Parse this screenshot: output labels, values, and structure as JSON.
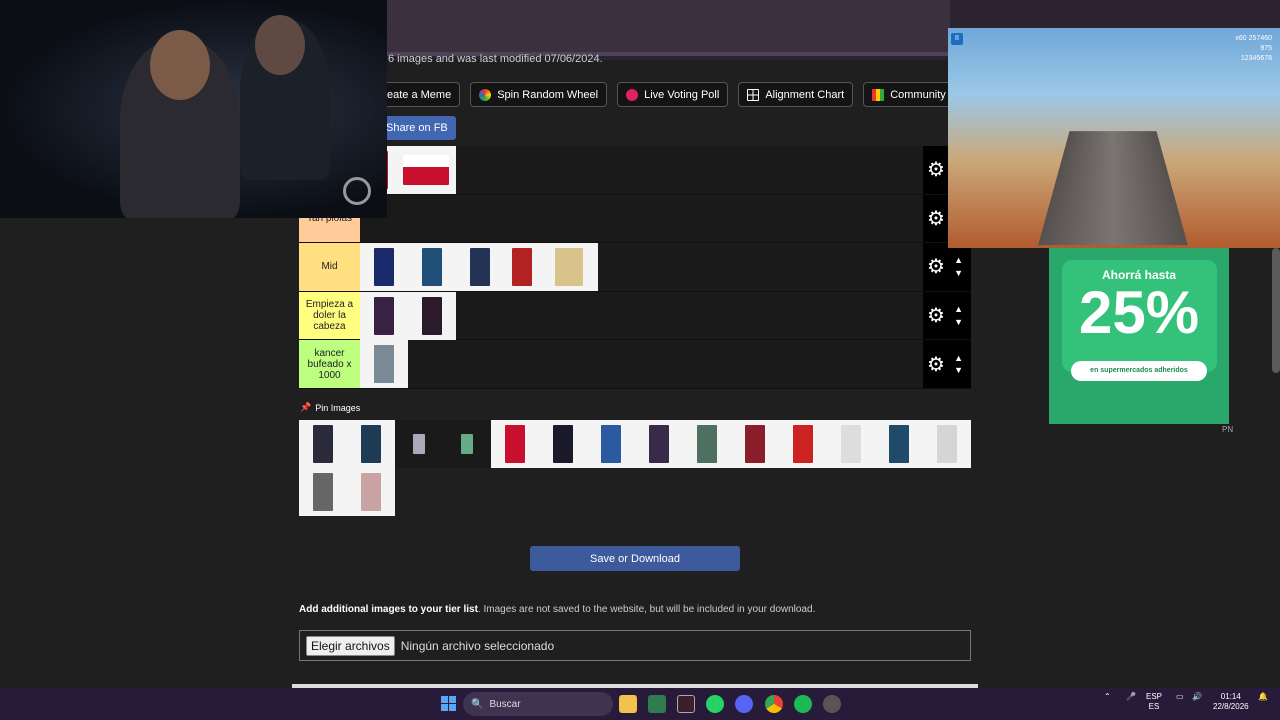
{
  "page": {
    "description_fragment": "6 images and was last modified 07/06/2024.",
    "buttons": {
      "meme": "eate a Meme",
      "wheel": "Spin Random Wheel",
      "poll": "Live Voting Poll",
      "alignment": "Alignment Chart",
      "community": "Community Rank",
      "share": "Share on FB"
    },
    "tiers": [
      {
        "label": "",
        "color": "#ffb3a0"
      },
      {
        "label": "Tan piolas",
        "color": "#ffcc99"
      },
      {
        "label": "Mid",
        "color": "#ffdf80"
      },
      {
        "label": "Empieza a doler la cabeza",
        "color": "#fffe7f"
      },
      {
        "label": "kancer bufeado x 1000",
        "color": "#bfff7f"
      }
    ],
    "pin_label": "Pin Images",
    "save_label": "Save or Download",
    "add_bold": "Add additional images to your tier list",
    "add_rest": ". Images are not saved to the website, but will be included in your download.",
    "file_button": "Elegir archivos",
    "file_status": "Ningún archivo seleccionado"
  },
  "game": {
    "score": "257460",
    "coins": "975",
    "multiplier": "x60",
    "id": "12345678"
  },
  "ad": {
    "top": "Ahorrá hasta",
    "big": "25%",
    "bottom": "en supermercados adheridos",
    "tag": "PN"
  },
  "taskbar": {
    "search": "Buscar",
    "lang": "ESP",
    "lang2": "ES",
    "time": "01:14",
    "date": "22/8/2026"
  }
}
